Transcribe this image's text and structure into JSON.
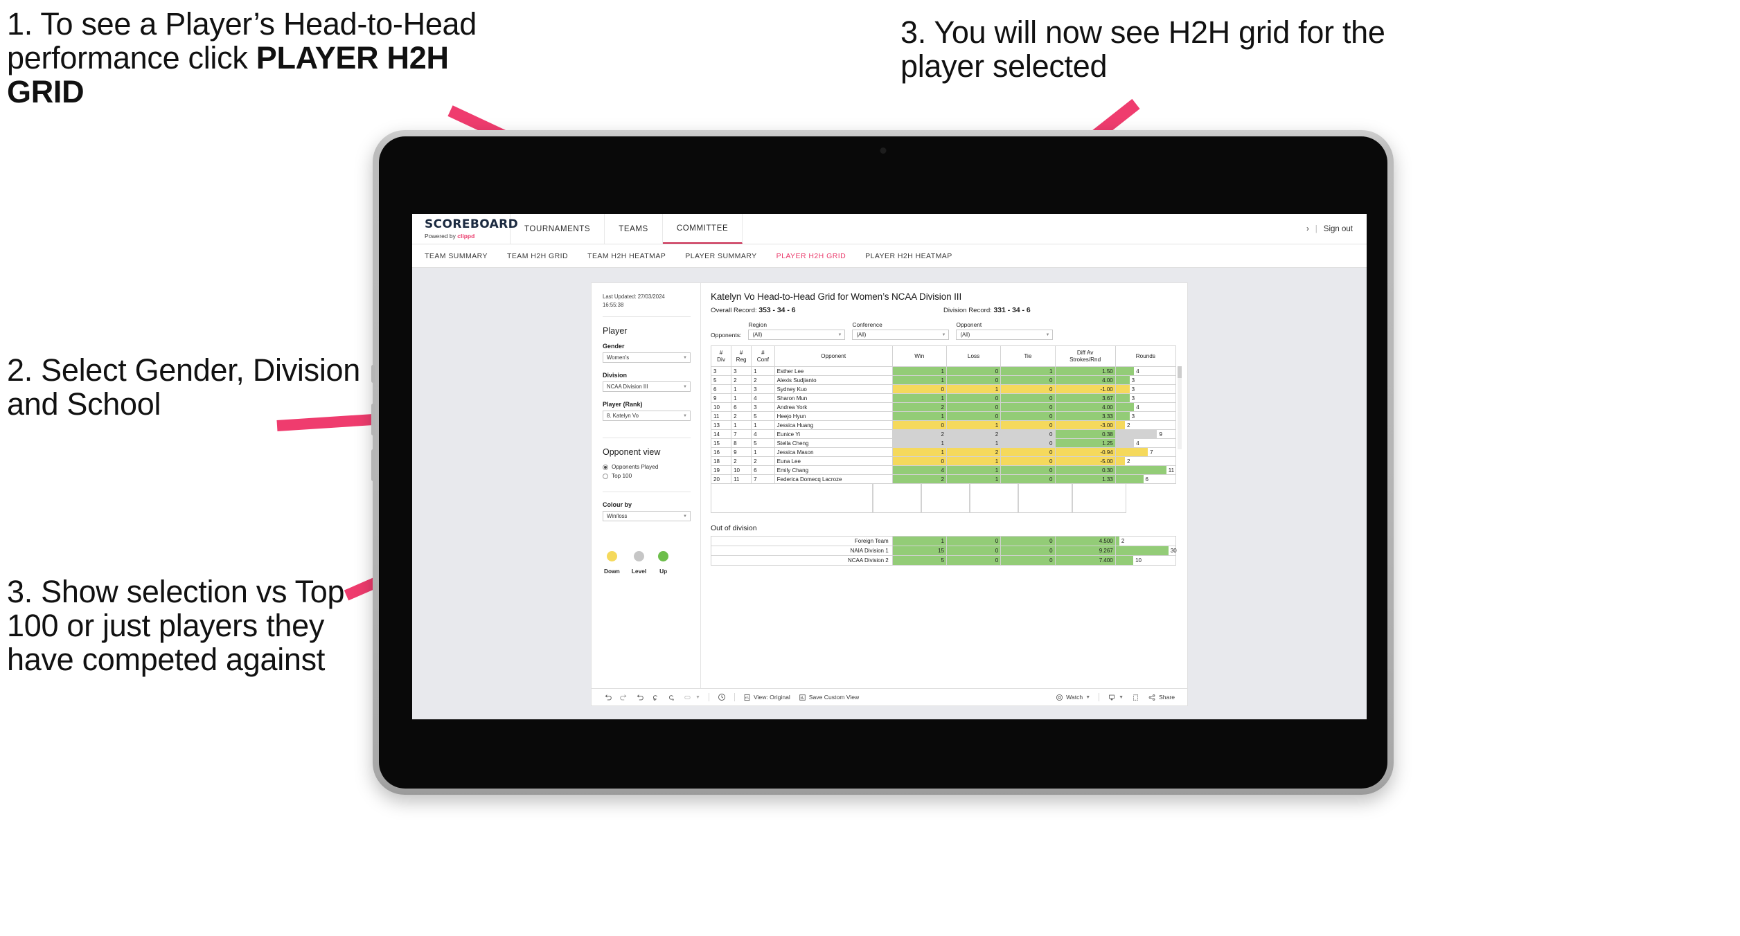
{
  "annotations": [
    {
      "id": "a1",
      "text_plain": "1. To see a Player’s Head-to-Head performance click ",
      "text_bold": "PLAYER H2H GRID"
    },
    {
      "id": "a2",
      "text": "2. Select Gender, Division and School"
    },
    {
      "id": "a3",
      "text": "3. Show selection vs Top 100 or just players they have competed against"
    },
    {
      "id": "a4",
      "text": "3. You will now see H2H grid for the player selected"
    }
  ],
  "app": {
    "brand": {
      "title": "SCOREBOARD",
      "powered_prefix": "Powered by ",
      "powered_brand": "clippd"
    },
    "topnav": [
      {
        "label": "TOURNAMENTS",
        "active": false
      },
      {
        "label": "TEAMS",
        "active": false
      },
      {
        "label": "COMMITTEE",
        "active": true
      }
    ],
    "signout": {
      "chevron": "›",
      "divider": "|",
      "label": "Sign out"
    },
    "subtabs": [
      {
        "label": "TEAM SUMMARY",
        "active": false
      },
      {
        "label": "TEAM H2H GRID",
        "active": false
      },
      {
        "label": "TEAM H2H HEATMAP",
        "active": false
      },
      {
        "label": "PLAYER SUMMARY",
        "active": false
      },
      {
        "label": "PLAYER H2H GRID",
        "active": true
      },
      {
        "label": "PLAYER H2H HEATMAP",
        "active": false
      }
    ],
    "accent_pink": "#ea3a6b",
    "underline_red": "#c9294f"
  },
  "sidebar": {
    "last_updated_label": "Last Updated: 27/03/2024",
    "last_updated_time": "16:55:38",
    "player_group_title": "Player",
    "fields": [
      {
        "label": "Gender",
        "value": "Women's"
      },
      {
        "label": "Division",
        "value": "NCAA Division III"
      },
      {
        "label": "Player (Rank)",
        "value": "8. Katelyn Vo"
      }
    ],
    "opponent_view": {
      "title": "Opponent view",
      "options": [
        {
          "label": "Opponents Played",
          "selected": true
        },
        {
          "label": "Top 100",
          "selected": false
        }
      ]
    },
    "colour_by": {
      "label": "Colour by",
      "value": "Win/loss"
    },
    "legend": [
      {
        "label": "Down",
        "color": "#f5d95c"
      },
      {
        "label": "Level",
        "color": "#c6c6c6"
      },
      {
        "label": "Up",
        "color": "#6dbe4b"
      }
    ]
  },
  "main": {
    "title": "Katelyn Vo Head-to-Head Grid for Women’s NCAA Division III",
    "overall_record_label": "Overall Record:",
    "overall_record_value": "353 - 34 - 6",
    "division_record_label": "Division Record:",
    "division_record_value": "331 - 34 - 6",
    "opponents_label": "Opponents:",
    "filters": [
      {
        "label": "Region",
        "value": "(All)"
      },
      {
        "label": "Conference",
        "value": "(All)"
      },
      {
        "label": "Opponent",
        "value": "(All)"
      }
    ],
    "columns": [
      "# Div",
      "# Reg",
      "# Conf",
      "Opponent",
      "Win",
      "Loss",
      "Tie",
      "Diff Av Strokes/Rnd",
      "Rounds"
    ],
    "rows": [
      {
        "div": "3",
        "reg": "3",
        "conf": "1",
        "opponent": "Esther Lee",
        "win": "1",
        "loss": "0",
        "tie": "1",
        "diff": "1.50",
        "rounds": "4",
        "state": "g"
      },
      {
        "div": "5",
        "reg": "2",
        "conf": "2",
        "opponent": "Alexis Sudjianto",
        "win": "1",
        "loss": "0",
        "tie": "0",
        "diff": "4.00",
        "rounds": "3",
        "state": "g"
      },
      {
        "div": "6",
        "reg": "1",
        "conf": "3",
        "opponent": "Sydney Kuo",
        "win": "0",
        "loss": "1",
        "tie": "0",
        "diff": "-1.00",
        "rounds": "3",
        "state": "y"
      },
      {
        "div": "9",
        "reg": "1",
        "conf": "4",
        "opponent": "Sharon Mun",
        "win": "1",
        "loss": "0",
        "tie": "0",
        "diff": "3.67",
        "rounds": "3",
        "state": "g"
      },
      {
        "div": "10",
        "reg": "6",
        "conf": "3",
        "opponent": "Andrea York",
        "win": "2",
        "loss": "0",
        "tie": "0",
        "diff": "4.00",
        "rounds": "4",
        "state": "g"
      },
      {
        "div": "11",
        "reg": "2",
        "conf": "5",
        "opponent": "Heejo Hyun",
        "win": "1",
        "loss": "0",
        "tie": "0",
        "diff": "3.33",
        "rounds": "3",
        "state": "g"
      },
      {
        "div": "13",
        "reg": "1",
        "conf": "1",
        "opponent": "Jessica Huang",
        "win": "0",
        "loss": "1",
        "tie": "0",
        "diff": "-3.00",
        "rounds": "2",
        "state": "y"
      },
      {
        "div": "14",
        "reg": "7",
        "conf": "4",
        "opponent": "Eunice Yi",
        "win": "2",
        "loss": "2",
        "tie": "0",
        "diff": "0.38",
        "rounds": "9",
        "state": "n",
        "diff_state": "g"
      },
      {
        "div": "15",
        "reg": "8",
        "conf": "5",
        "opponent": "Stella Cheng",
        "win": "1",
        "loss": "1",
        "tie": "0",
        "diff": "1.25",
        "rounds": "4",
        "state": "n",
        "diff_state": "g"
      },
      {
        "div": "16",
        "reg": "9",
        "conf": "1",
        "opponent": "Jessica Mason",
        "win": "1",
        "loss": "2",
        "tie": "0",
        "diff": "-0.94",
        "rounds": "7",
        "state": "y"
      },
      {
        "div": "18",
        "reg": "2",
        "conf": "2",
        "opponent": "Euna Lee",
        "win": "0",
        "loss": "1",
        "tie": "0",
        "diff": "-5.00",
        "rounds": "2",
        "state": "y"
      },
      {
        "div": "19",
        "reg": "10",
        "conf": "6",
        "opponent": "Emily Chang",
        "win": "4",
        "loss": "1",
        "tie": "0",
        "diff": "0.30",
        "rounds": "11",
        "state": "g"
      },
      {
        "div": "20",
        "reg": "11",
        "conf": "7",
        "opponent": "Federica Domecq Lacroze",
        "win": "2",
        "loss": "1",
        "tie": "0",
        "diff": "1.33",
        "rounds": "6",
        "state": "g"
      }
    ],
    "rounds_max": 13,
    "out_of_division": {
      "title": "Out of division",
      "rows": [
        {
          "label": "Foreign Team",
          "win": "1",
          "loss": "0",
          "tie": "0",
          "diff": "4.500",
          "rounds": "2",
          "state": "g"
        },
        {
          "label": "NAIA Division 1",
          "win": "15",
          "loss": "0",
          "tie": "0",
          "diff": "9.267",
          "rounds": "30",
          "state": "g"
        },
        {
          "label": "NCAA Division 2",
          "win": "5",
          "loss": "0",
          "tie": "0",
          "diff": "7.400",
          "rounds": "10",
          "state": "g"
        }
      ],
      "rounds_max": 34
    }
  },
  "toolbar": {
    "items": [
      {
        "name": "undo",
        "icon": "undo-icon"
      },
      {
        "name": "redo",
        "icon": "redo-icon"
      },
      {
        "name": "revert",
        "icon": "revert-icon"
      },
      {
        "name": "refresh",
        "icon": "refresh-icon"
      },
      {
        "name": "pause",
        "icon": "pause-data-icon"
      },
      {
        "name": "back",
        "icon": "back-icon"
      }
    ],
    "clock_icon": "clock-icon",
    "view_label": "View: Original",
    "save_label": "Save Custom View",
    "watch_label": "Watch",
    "share_label": "Share"
  },
  "colors": {
    "green": "#93cc77",
    "yellow": "#f5d95c",
    "neutral": "#d2d2d2",
    "pink_arrow": "#ef3c6e"
  }
}
